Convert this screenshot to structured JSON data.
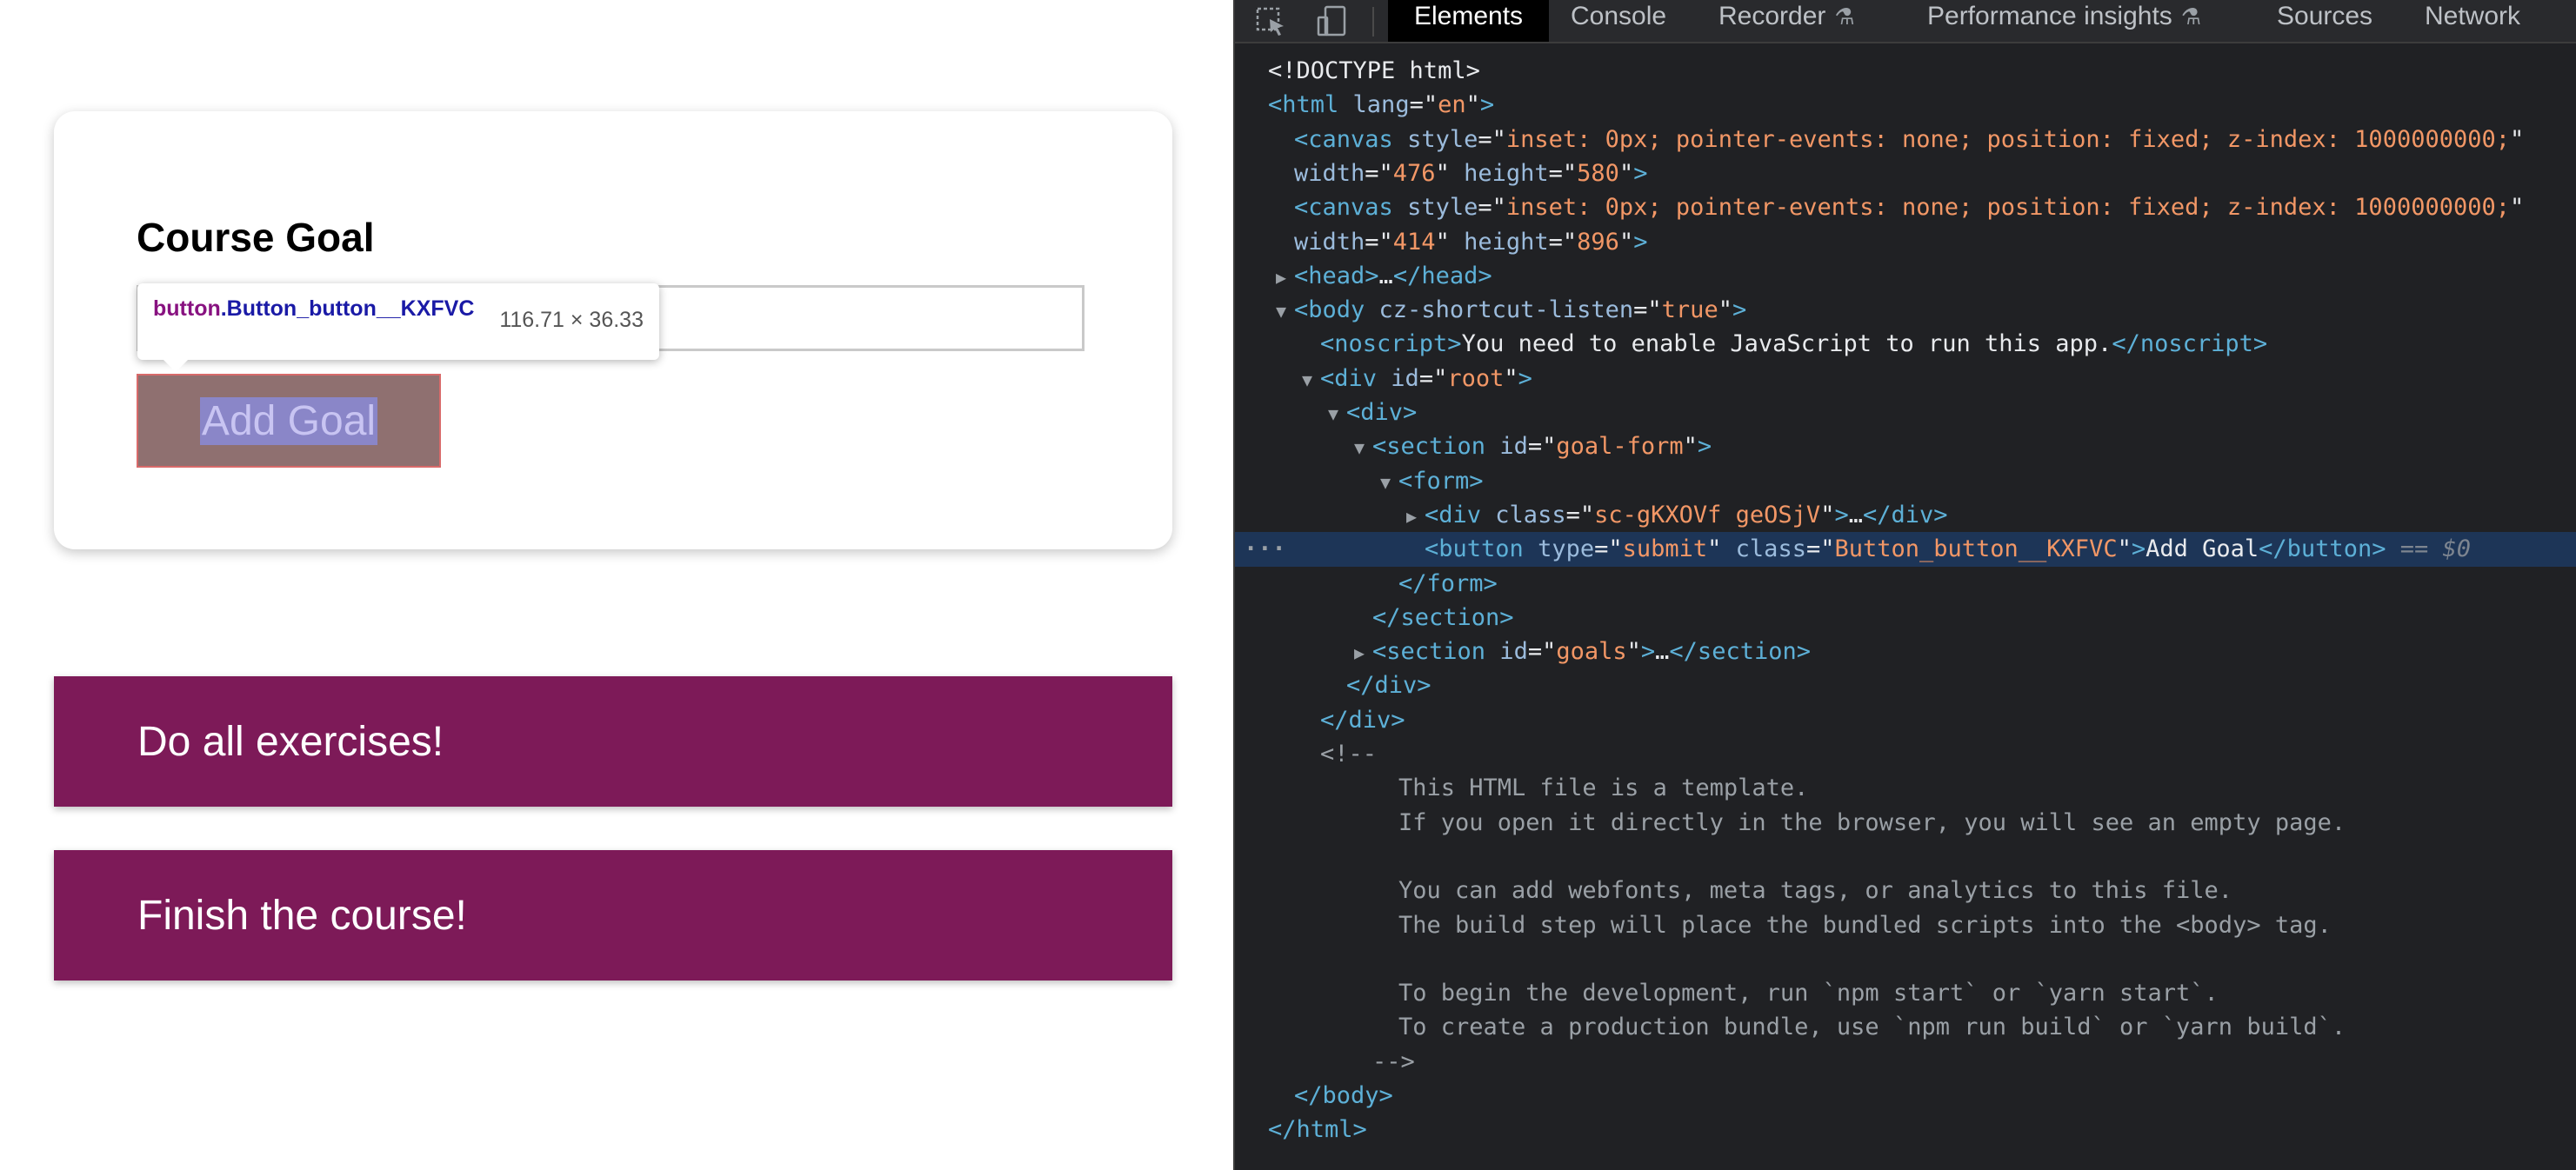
{
  "page": {
    "form_title": "Course Goal",
    "input_value": "",
    "add_button_label": "Add Goal",
    "tooltip": {
      "tag": "button",
      "class_name": ".Button_button__KXFVC",
      "size": "116.71 × 36.33"
    },
    "goals": [
      "Do all exercises!",
      "Finish the course!"
    ],
    "goal_color": "#7d1a58"
  },
  "devtools": {
    "tabs": [
      "Elements",
      "Console",
      "Recorder",
      "Performance insights",
      "Sources",
      "Network"
    ],
    "active_tab": "Elements",
    "icons": [
      "inspect-element-icon",
      "device-toolbar-icon",
      "flask-icon"
    ],
    "lines": [
      {
        "indent": 0,
        "tri": "",
        "html": "<span class='txt'>&lt;!DOCTYPE html&gt;</span>"
      },
      {
        "indent": 0,
        "tri": "",
        "html": "<span class='t'>&lt;html</span> <span class='a'>lang</span>=\"<span class='v'>en</span>\"<span class='t'>&gt;</span>"
      },
      {
        "indent": 1,
        "tri": "",
        "html": "<span class='t'>&lt;canvas</span> <span class='a'>style</span>=\"<span class='v'>inset: 0px; pointer-events: none; position: fixed; z-index: 1000000000;</span>\""
      },
      {
        "indent": 1,
        "tri": "",
        "html": "<span class='a'>width</span>=\"<span class='v'>476</span>\" <span class='a'>height</span>=\"<span class='v'>580</span>\"<span class='t'>&gt;</span>"
      },
      {
        "indent": 1,
        "tri": "",
        "html": "<span class='t'>&lt;canvas</span> <span class='a'>style</span>=\"<span class='v'>inset: 0px; pointer-events: none; position: fixed; z-index: 1000000000;</span>\""
      },
      {
        "indent": 1,
        "tri": "",
        "html": "<span class='a'>width</span>=\"<span class='v'>414</span>\" <span class='a'>height</span>=\"<span class='v'>896</span>\"<span class='t'>&gt;</span>"
      },
      {
        "indent": 1,
        "tri": "▶",
        "html": "<span class='t'>&lt;head&gt;</span>…<span class='t'>&lt;/head&gt;</span>"
      },
      {
        "indent": 1,
        "tri": "▼",
        "html": "<span class='t'>&lt;body</span> <span class='a'>cz-shortcut-listen</span>=\"<span class='v'>true</span>\"<span class='t'>&gt;</span>"
      },
      {
        "indent": 2,
        "tri": "",
        "html": "<span class='t'>&lt;noscript&gt;</span><span class='txt'>You need to enable JavaScript to run this app.</span><span class='t'>&lt;/noscript&gt;</span>"
      },
      {
        "indent": 2,
        "tri": "▼",
        "html": "<span class='t'>&lt;div</span> <span class='a'>id</span>=\"<span class='v'>root</span>\"<span class='t'>&gt;</span>"
      },
      {
        "indent": 3,
        "tri": "▼",
        "html": "<span class='t'>&lt;div&gt;</span>"
      },
      {
        "indent": 4,
        "tri": "▼",
        "html": "<span class='t'>&lt;section</span> <span class='a'>id</span>=\"<span class='v'>goal-form</span>\"<span class='t'>&gt;</span>"
      },
      {
        "indent": 5,
        "tri": "▼",
        "html": "<span class='t'>&lt;form&gt;</span>"
      },
      {
        "indent": 6,
        "tri": "▶",
        "html": "<span class='t'>&lt;div</span> <span class='a'>class</span>=\"<span class='v'>sc-gKXOVf geOSjV</span>\"<span class='t'>&gt;</span>…<span class='t'>&lt;/div&gt;</span>"
      },
      {
        "indent": 6,
        "tri": "",
        "sel": true,
        "html": "<span class='t'>&lt;button</span> <span class='a'>type</span>=\"<span class='v'>submit</span>\" <span class='a'>class</span>=\"<span class='v'>Button_button__KXFVC</span>\"<span class='t'>&gt;</span><span class='txt'>Add Goal</span><span class='t'>&lt;/button&gt;</span> <span class='eq'>== $0</span>"
      },
      {
        "indent": 5,
        "tri": "",
        "html": "<span class='t'>&lt;/form&gt;</span>"
      },
      {
        "indent": 4,
        "tri": "",
        "html": "<span class='t'>&lt;/section&gt;</span>"
      },
      {
        "indent": 4,
        "tri": "▶",
        "html": "<span class='t'>&lt;section</span> <span class='a'>id</span>=\"<span class='v'>goals</span>\"<span class='t'>&gt;</span>…<span class='t'>&lt;/section&gt;</span>"
      },
      {
        "indent": 3,
        "tri": "",
        "html": "<span class='t'>&lt;/div&gt;</span>"
      },
      {
        "indent": 2,
        "tri": "",
        "html": "<span class='t'>&lt;/div&gt;</span>"
      },
      {
        "indent": 2,
        "tri": "",
        "html": "<span class='cm'>&lt;!--</span>"
      },
      {
        "indent": 5,
        "tri": "",
        "html": "<span class='cm'>This HTML file is a template.</span>"
      },
      {
        "indent": 5,
        "tri": "",
        "html": "<span class='cm'>If you open it directly in the browser, you will see an empty page.</span>"
      },
      {
        "indent": 5,
        "tri": "",
        "html": ""
      },
      {
        "indent": 5,
        "tri": "",
        "html": "<span class='cm'>You can add webfonts, meta tags, or analytics to this file.</span>"
      },
      {
        "indent": 5,
        "tri": "",
        "html": "<span class='cm'>The build step will place the bundled scripts into the &lt;body&gt; tag.</span>"
      },
      {
        "indent": 5,
        "tri": "",
        "html": ""
      },
      {
        "indent": 5,
        "tri": "",
        "html": "<span class='cm'>To begin the development, run `npm start` or `yarn start`.</span>"
      },
      {
        "indent": 5,
        "tri": "",
        "html": "<span class='cm'>To create a production bundle, use `npm run build` or `yarn build`.</span>"
      },
      {
        "indent": 4,
        "tri": "",
        "html": "<span class='cm'>--&gt;</span>"
      },
      {
        "indent": 1,
        "tri": "",
        "html": "<span class='t'>&lt;/body&gt;</span>"
      },
      {
        "indent": 0,
        "tri": "",
        "html": "<span class='t'>&lt;/html&gt;</span>"
      }
    ]
  }
}
